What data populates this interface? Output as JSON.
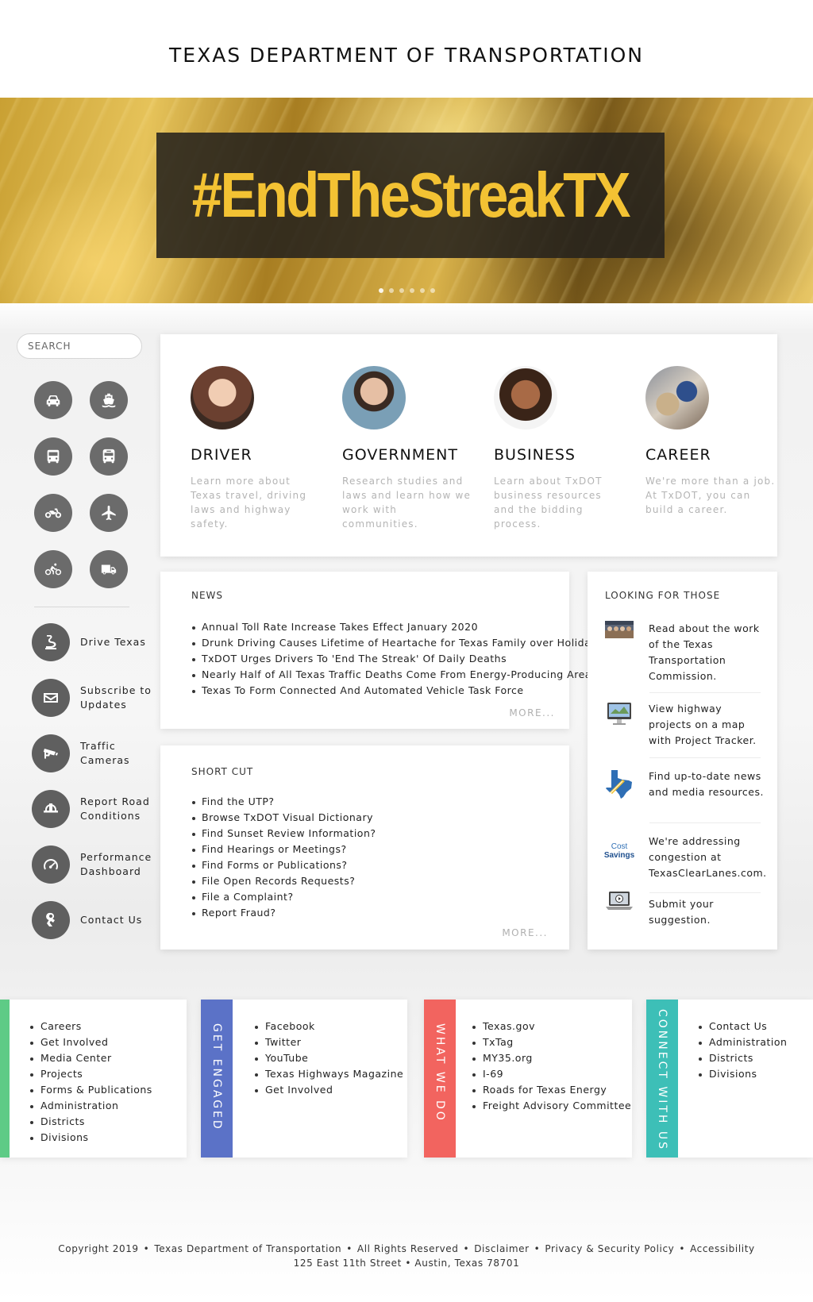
{
  "header": {
    "title": "TEXAS DEPARTMENT OF TRANSPORTATION"
  },
  "hero": {
    "headline": "#EndTheStreakTX",
    "slide_count": 6,
    "active_slide": 1
  },
  "sidebar": {
    "search_placeholder": "SEARCH",
    "mode_icons": [
      "car-icon",
      "ferry-icon",
      "bus-icon",
      "transit-bus-icon",
      "motorcycle-icon",
      "airplane-icon",
      "bicycle-icon",
      "truck-icon"
    ],
    "quick_links": [
      {
        "label": "Drive Texas",
        "icon": "road-icon"
      },
      {
        "label": "Subscribe to Updates",
        "icon": "envelope-icon"
      },
      {
        "label": "Traffic Cameras",
        "icon": "camera-icon"
      },
      {
        "label": "Report Road Conditions",
        "icon": "hardhat-icon"
      },
      {
        "label": "Performance Dashboard",
        "icon": "gauge-icon"
      },
      {
        "label": "Contact Us",
        "icon": "contact-icon"
      }
    ]
  },
  "audiences": [
    {
      "title": "DRIVER",
      "description": "Learn more about Texas travel, driving laws and highway safety."
    },
    {
      "title": "GOVERNMENT",
      "description": "Research studies and laws and learn how we work with communities."
    },
    {
      "title": "BUSINESS",
      "description": "Learn about TxDOT business resources and the bidding process."
    },
    {
      "title": "CAREER",
      "description": "We're more than a job. At TxDOT, you can build a career."
    }
  ],
  "news": {
    "heading": "NEWS",
    "items": [
      "Annual Toll Rate Increase Takes Effect January 2020",
      "Drunk Driving Causes Lifetime of Heartache for Texas Family over Holidays",
      "TxDOT Urges Drivers To 'End The Streak' Of Daily Deaths",
      "Nearly Half of All Texas Traffic Deaths Come From Energy-Producing Areas",
      "Texas To Form Connected And Automated Vehicle Task Force"
    ],
    "more": "MORE..."
  },
  "shortcut": {
    "heading": "SHORT CUT",
    "items": [
      "Find the UTP?",
      "Browse TxDOT Visual Dictionary",
      "Find Sunset Review Information?",
      "Find Hearings or Meetings?",
      "Find Forms or Publications?",
      "File Open Records Requests?",
      "File a Complaint?",
      "Report Fraud?"
    ],
    "more": "MORE..."
  },
  "looking": {
    "heading": "LOOKING FOR THOSE",
    "items": [
      {
        "text": "Read about the work of the Texas Transportation Commission.",
        "icon": "commission-photo-icon"
      },
      {
        "text": "View highway projects on a map with Project Tracker.",
        "icon": "monitor-icon"
      },
      {
        "text": "Find up-to-date news and media resources.",
        "icon": "texas-map-icon"
      },
      {
        "text": "We're addressing congestion at TexasClearLanes.com.",
        "icon": "cost-savings-icon",
        "icon_text_1": "Cost",
        "icon_text_2": "Savings"
      },
      {
        "text": "Submit your suggestion.",
        "icon": "laptop-icon"
      }
    ]
  },
  "footer_blocks": [
    {
      "label": "",
      "color": "#5ecb86",
      "items": [
        "Careers",
        "Get Involved",
        "Media Center",
        "Projects",
        "Forms & Publications",
        "Administration",
        "Districts",
        "Divisions"
      ]
    },
    {
      "label": "GET ENGAGED",
      "color": "#5b72c7",
      "items": [
        "Facebook",
        "Twitter",
        "YouTube",
        "Texas Highways Magazine",
        "Get Involved"
      ]
    },
    {
      "label": "WHAT WE DO",
      "color": "#f2645f",
      "items": [
        "Texas.gov",
        "TxTag",
        "MY35.org",
        "I-69",
        "Roads for Texas Energy",
        "Freight Advisory Committee"
      ]
    },
    {
      "label": "CONNECT WITH US",
      "color": "#3dbfb7",
      "items": [
        "Contact Us",
        "Administration",
        "Districts",
        "Divisions"
      ]
    }
  ],
  "copyright": {
    "copyright_text": "Copyright 2019",
    "org": "Texas Department of Transportation",
    "rights": "All Rights Reserved",
    "disclaimer": "Disclaimer",
    "privacy": "Privacy & Security Policy",
    "accessibility": "Accessibility",
    "address": "125 East 11th Street • Austin, Texas 78701"
  }
}
